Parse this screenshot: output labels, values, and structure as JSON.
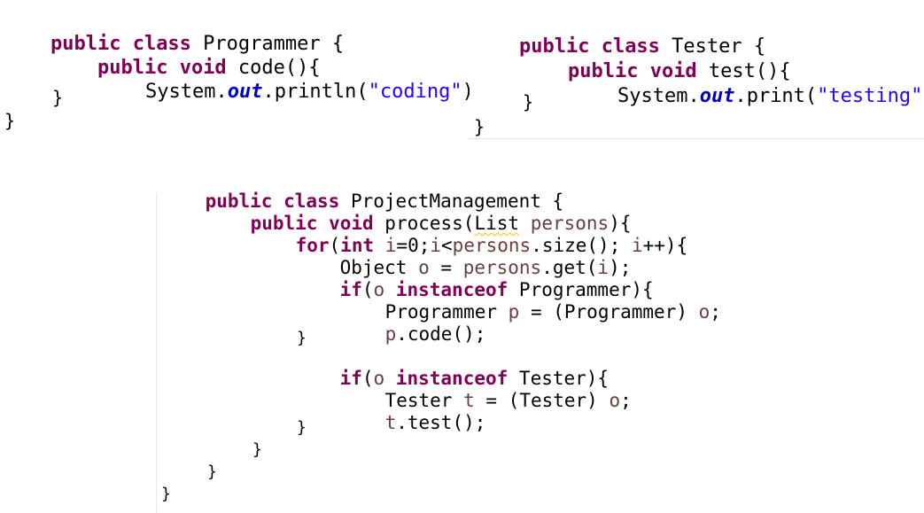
{
  "snippets": {
    "programmer": {
      "line1": {
        "kw": "public class",
        "rest": " Programmer {"
      },
      "line2": {
        "kw": "public void",
        "rest": " code(){"
      },
      "line3": {
        "a": "System.",
        "field": "out",
        "b": ".println(",
        "str": "\"coding\"",
        "c": ");"
      },
      "line4": "}",
      "line5": "}"
    },
    "tester": {
      "line1": {
        "kw": "public class",
        "rest": " Tester {"
      },
      "line2": {
        "kw": "public void",
        "rest": " test(){"
      },
      "line3": {
        "a": "System.",
        "field": "out",
        "b": ".print(",
        "str": "\"testing\"",
        "c": ");"
      },
      "line4": "}",
      "line5": "}"
    },
    "project_management": {
      "line1": {
        "kw": "public class",
        "rest": " ProjectManagement {"
      },
      "line2": {
        "kw": "public void",
        "a": " process(",
        "type": "List",
        "sp": " ",
        "param": "persons",
        "b": "){"
      },
      "line3": {
        "kw_for": "for",
        "paren": "(",
        "kw_int": "int",
        "sp": " ",
        "v1": "i",
        "t1": "=0;",
        "v2": "i",
        "t2": "<",
        "v3": "persons",
        "t3": ".size(); ",
        "v4": "i",
        "t4": "++){"
      },
      "line4": {
        "a": "Object ",
        "v1": "o",
        "b": " = ",
        "v2": "persons",
        "c": ".get(",
        "v3": "i",
        "d": ");"
      },
      "line5": {
        "kw_if": "if",
        "a": "(",
        "v": "o",
        "sp": " ",
        "kw_inst": "instanceof",
        "b": " Programmer){"
      },
      "line6": {
        "a": "Programmer ",
        "v1": "p",
        "b": " = (Programmer) ",
        "v2": "o",
        "c": ";"
      },
      "line7": {
        "v": "p",
        "a": ".code();"
      },
      "line8": "}",
      "line9": {
        "kw_if": "if",
        "a": "(",
        "v": "o",
        "sp": " ",
        "kw_inst": "instanceof",
        "b": " Tester){"
      },
      "line10": {
        "a": "Tester ",
        "v1": "t",
        "b": " = (Tester) ",
        "v2": "o",
        "c": ";"
      },
      "line11": {
        "v": "t",
        "a": ".test();"
      },
      "line12": "}",
      "line13": "}",
      "line14": "}",
      "line15": "}"
    }
  },
  "colors": {
    "keyword": "#7f0055",
    "string": "#2a00ff",
    "static_field": "#0000c0",
    "local_variable": "#6a3e3e",
    "warning_underline": "#f5c400"
  }
}
